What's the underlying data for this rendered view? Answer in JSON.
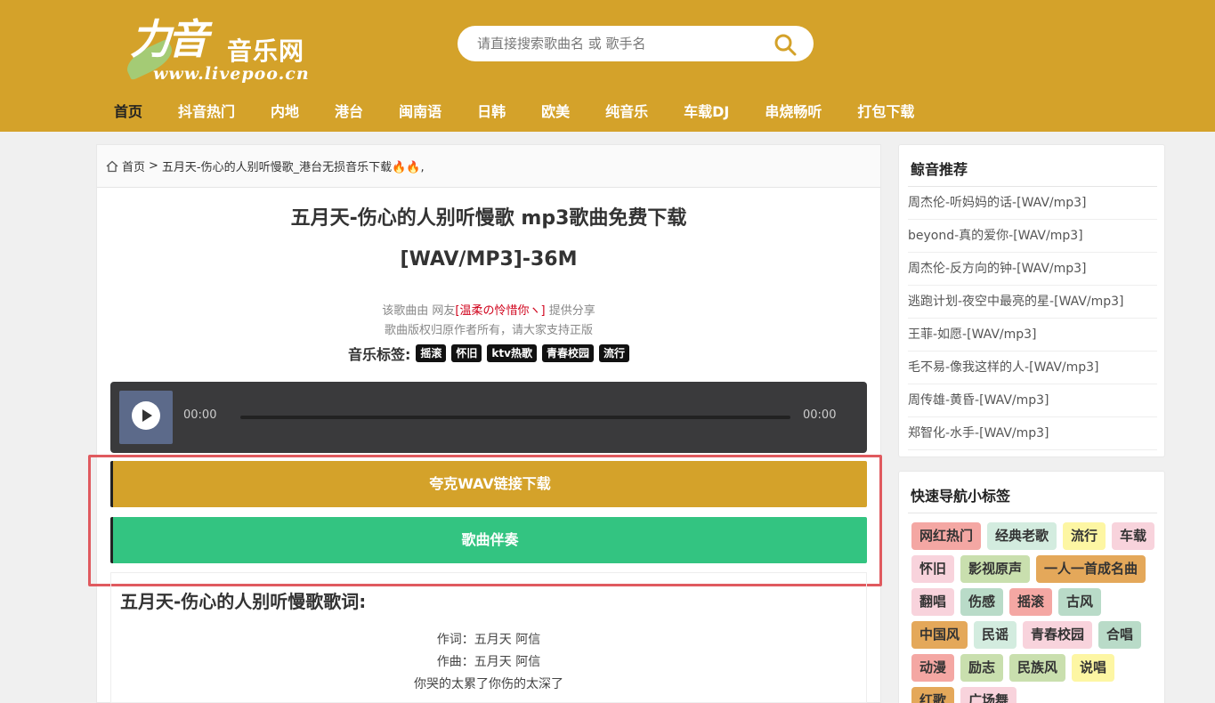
{
  "brand": {
    "logo_big": "力音",
    "logo_cn": "音乐网",
    "logo_url": "www.livepoo.cn"
  },
  "search": {
    "placeholder": "请直接搜索歌曲名 或 歌手名"
  },
  "nav": [
    "首页",
    "抖音热门",
    "内地",
    "港台",
    "闽南语",
    "日韩",
    "欧美",
    "纯音乐",
    "车载DJ",
    "串烧畅听",
    "打包下载"
  ],
  "breadcrumb": {
    "home": "首页",
    "sep": ">",
    "current": "五月天-伤心的人别听慢歌_港台无损音乐下载🔥🔥,"
  },
  "song": {
    "title_line1": "五月天-伤心的人别听慢歌 mp3歌曲免费下载",
    "title_line2": "[WAV/MP3]-36M",
    "share_prefix": "该歌曲由 网友",
    "share_user": "[温柔の怜惜你ヽ]",
    "share_suffix": " 提供分享",
    "copyright": "歌曲版权归原作者所有，请大家支持正版",
    "tags_label": "音乐标签:",
    "tags": [
      "摇滚",
      "怀旧",
      "ktv热歌",
      "青春校园",
      "流行"
    ]
  },
  "player": {
    "current_time": "00:00",
    "duration": "00:00",
    "progress": 0
  },
  "buttons": {
    "download": "夸克WAV链接下载",
    "accompaniment": "歌曲伴奏"
  },
  "lyrics": {
    "heading": "五月天-伤心的人别听慢歌歌词:",
    "lines": [
      "作词：五月天 阿信",
      "作曲：五月天 阿信",
      "你哭的太累了你伤的太深了"
    ]
  },
  "sidebar": {
    "recommend_title": "鲸音推荐",
    "recommend": [
      "周杰伦-听妈妈的话-[WAV/mp3]",
      "beyond-真的爱你-[WAV/mp3]",
      "周杰伦-反方向的钟-[WAV/mp3]",
      "逃跑计划-夜空中最亮的星-[WAV/mp3]",
      "王菲-如愿-[WAV/mp3]",
      "毛不易-像我这样的人-[WAV/mp3]",
      "周传雄-黄昏-[WAV/mp3]",
      "郑智化-水手-[WAV/mp3]"
    ],
    "quick_title": "快速导航小标签",
    "quick_tags": [
      {
        "label": "网红热门",
        "color": "#f4a7a3"
      },
      {
        "label": "经典老歌",
        "color": "#d3ecdf"
      },
      {
        "label": "流行",
        "color": "#fdf6a3"
      },
      {
        "label": "车载",
        "color": "#f8d3dc"
      },
      {
        "label": "怀旧",
        "color": "#f8d3dc"
      },
      {
        "label": "影视原声",
        "color": "#c9dfae"
      },
      {
        "label": "一人一首成名曲",
        "color": "#e4a85a"
      },
      {
        "label": "翻唱",
        "color": "#f8d3dc"
      },
      {
        "label": "伤感",
        "color": "#b9dbc8"
      },
      {
        "label": "摇滚",
        "color": "#f4a7a3"
      },
      {
        "label": "古风",
        "color": "#b9dbc8"
      },
      {
        "label": "中国风",
        "color": "#e4a85a"
      },
      {
        "label": "民谣",
        "color": "#d3ecdf"
      },
      {
        "label": "青春校园",
        "color": "#f8d3dc"
      },
      {
        "label": "合唱",
        "color": "#b9dbc8"
      },
      {
        "label": "动漫",
        "color": "#f4a7a3"
      },
      {
        "label": "励志",
        "color": "#c9dfae"
      },
      {
        "label": "民族风",
        "color": "#c9dfae"
      },
      {
        "label": "说唱",
        "color": "#fdf6a3"
      },
      {
        "label": "红歌",
        "color": "#e4a85a"
      },
      {
        "label": "广场舞",
        "color": "#f8d3dc"
      }
    ]
  },
  "colors": {
    "brand": "#d4a22a",
    "download_btn": "#d4a22a",
    "accompaniment_btn": "#33c481",
    "highlight": "#e05a5f"
  }
}
